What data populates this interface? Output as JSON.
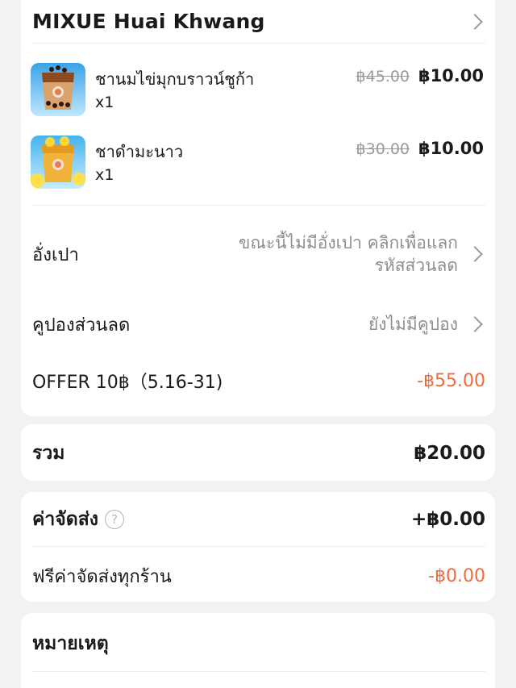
{
  "store": {
    "name": "MIXUE Huai Khwang"
  },
  "items": [
    {
      "name": "ชานมไข่มุกบราวน์ชูก้า",
      "qty": "x1",
      "old_price": "฿45.00",
      "price": "฿10.00"
    },
    {
      "name": "ชาดำมะนาว",
      "qty": "x1",
      "old_price": "฿30.00",
      "price": "฿10.00"
    }
  ],
  "angpao": {
    "label": "อั่งเปา",
    "hint_line1": "ขณะนี้ไม่มีอั่งเปา คลิกเพื่อแลก",
    "hint_line2": "รหัสส่วนลด"
  },
  "coupon": {
    "label": "คูปองส่วนลด",
    "hint": "ยังไม่มีคูปอง"
  },
  "offer": {
    "label": "OFFER 10฿（5.16-31)",
    "amount": "-฿55.00"
  },
  "total": {
    "label": "รวม",
    "amount": "฿20.00"
  },
  "delivery": {
    "label": "ค่าจัดส่ง",
    "help_symbol": "?",
    "amount": "+฿0.00",
    "free_label": "ฟรีค่าจัดส่งทุกร้าน",
    "free_amount": "-฿0.00"
  },
  "note": {
    "label": "หมายเหตุ"
  },
  "colors": {
    "discount": "#f06a3b",
    "background": "#f2f2f4"
  }
}
